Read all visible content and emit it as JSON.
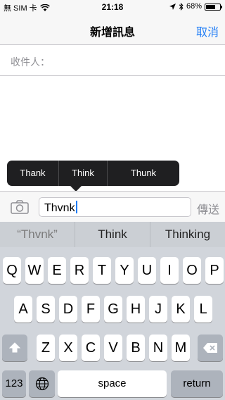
{
  "status_bar": {
    "carrier": "無 SIM 卡",
    "time": "21:18",
    "battery": "68%",
    "battery_level": 0.68
  },
  "nav": {
    "title": "新增訊息",
    "cancel": "取消"
  },
  "recipient": {
    "label": "收件人：",
    "value": ""
  },
  "popup": {
    "items": [
      "Thank",
      "Think",
      "Thunk"
    ]
  },
  "input_bar": {
    "text": "Thvnk",
    "send": "傳送"
  },
  "quicktype": {
    "items": [
      "“Thvnk”",
      "Think",
      "Thinking"
    ]
  },
  "keyboard": {
    "row1": [
      "Q",
      "W",
      "E",
      "R",
      "T",
      "Y",
      "U",
      "I",
      "O",
      "P"
    ],
    "row2": [
      "A",
      "S",
      "D",
      "F",
      "G",
      "H",
      "J",
      "K",
      "L"
    ],
    "row3": [
      "Z",
      "X",
      "C",
      "V",
      "B",
      "N",
      "M"
    ],
    "numbers": "123",
    "space": "space",
    "return": "return"
  },
  "icons": {
    "accent": "#1e7cf6"
  }
}
